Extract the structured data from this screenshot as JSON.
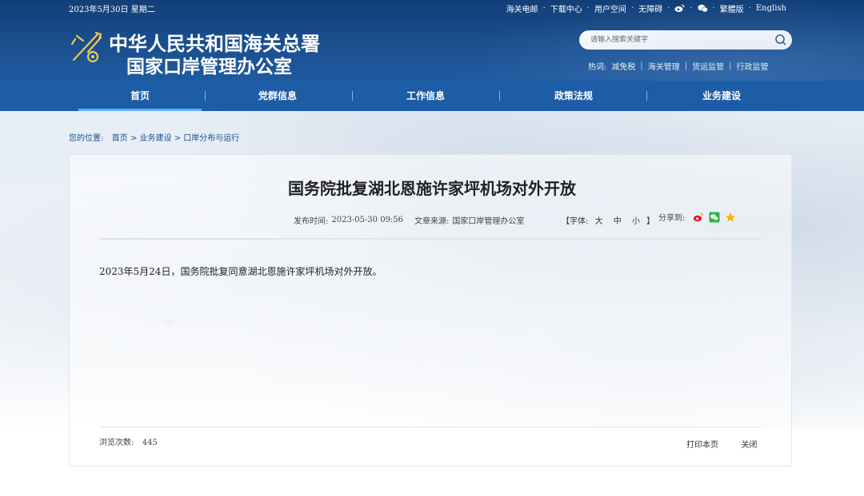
{
  "topbar": {
    "date": "2023年5月30日 星期二",
    "links": [
      {
        "label": "海关电邮"
      },
      {
        "label": "下载中心"
      },
      {
        "label": "用户空间"
      },
      {
        "label": "无障碍"
      },
      {
        "icon": "weibo-icon"
      },
      {
        "icon": "wechat-icon"
      },
      {
        "label": "繁體版"
      },
      {
        "label": "English"
      }
    ],
    "separator": "·"
  },
  "logo": {
    "line1": "中华人民共和国海关总署",
    "line2": "国家口岸管理办公室"
  },
  "search": {
    "placeholder": "请输入搜索关键字"
  },
  "hotwords": {
    "label": "热词:",
    "items": [
      "减免税",
      "海关管理",
      "货运监管",
      "行政监管"
    ],
    "separator": "|"
  },
  "nav": {
    "items": [
      {
        "label": "首页"
      },
      {
        "label": "党群信息"
      },
      {
        "label": "工作信息"
      },
      {
        "label": "政策法规"
      },
      {
        "label": "业务建设"
      }
    ],
    "active_index": 0
  },
  "breadcrumb": {
    "label": "您的位置:",
    "items": [
      "首页",
      "业务建设",
      "口岸分布与运行"
    ],
    "separator": ">"
  },
  "article": {
    "title": "国务院批复湖北恩施许家坪机场对外开放",
    "publish_label": "发布时间:",
    "publish_time": "2023-05-30 09:56",
    "source_label": "文章来源:",
    "source": "国家口岸管理办公室",
    "fontsize_open": "【字体:",
    "fontsize_options": [
      "大",
      "中",
      "小"
    ],
    "fontsize_close": "】",
    "share_label": "分享到:",
    "body": "2023年5月24日，国务院批复同意湖北恩施许家坪机场对外开放。",
    "views_label": "浏览次数:",
    "views": "445",
    "print_label": "打印本页",
    "close_label": "关闭"
  },
  "colors": {
    "header_bg": "#1a4f8f",
    "nav_bg": "#1d5ca6",
    "nav_active_underline": "#5fb0ef",
    "link": "#1d4f8e"
  }
}
